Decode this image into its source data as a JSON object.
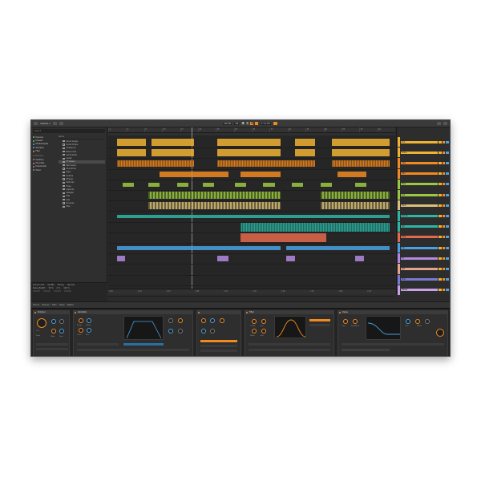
{
  "titlebar": {
    "project": "Untitled 1",
    "tempo": "120.00",
    "signature": "4/4",
    "position": "1.1.1.00",
    "transport_play": "▶",
    "transport_stop": "■",
    "transport_rec": "●"
  },
  "browser": {
    "search_placeholder": "Search",
    "places": [
      {
        "label": "Devices",
        "color": "#5bc55b"
      },
      {
        "label": "Presets",
        "color": "#5bc55b"
      },
      {
        "label": "Multisamples",
        "color": "#4aa7e8"
      },
      {
        "label": "Samples",
        "color": "#4aa7e8"
      },
      {
        "label": "Files",
        "color": "#f08a21"
      }
    ],
    "section_collections": "Collections",
    "collections": [
      {
        "label": "Desktop",
        "color": "#888888"
      },
      {
        "label": "Favorites",
        "color": "#e86aa8"
      },
      {
        "label": "Downloads",
        "color": "#888888"
      },
      {
        "label": "Music",
        "color": "#888888"
      }
    ],
    "list_header": "Name",
    "rows": [
      "Drum Loops",
      "Vocal Chops",
      "Ambience",
      "Bass Lines",
      "Synth Pads",
      "Leads",
      "FX Risers",
      "Percussion",
      "One Shots",
      "Keys",
      "Guitars",
      "Strings",
      "Textures",
      "Foley",
      "Impacts",
      "Sweeps",
      "Hits",
      "Kits",
      "Grooves",
      "Misc"
    ],
    "selected_row": 6
  },
  "info": {
    "labels": [
      "Groove Amt",
      "Shuffle",
      "Timing",
      "Velocity"
    ],
    "values": [
      "Swing Eighth",
      "50 %",
      "0 %",
      "100 %"
    ]
  },
  "ruler": [
    "1",
    "5",
    "9",
    "13",
    "17",
    "21",
    "25",
    "29",
    "33",
    "37",
    "41",
    "45",
    "49",
    "53",
    "57",
    "61"
  ],
  "footer_times": [
    "0:00",
    "0:16",
    "0:32",
    "0:48",
    "1:04",
    "1:20",
    "1:36",
    "1:52",
    "2:08",
    "2:24"
  ],
  "tracks": [
    {
      "name": "Kick",
      "color": "#f0b232"
    },
    {
      "name": "Snare",
      "color": "#f0b232"
    },
    {
      "name": "Hats",
      "color": "#f08a21"
    },
    {
      "name": "Perc",
      "color": "#f08a21"
    },
    {
      "name": "Bass",
      "color": "#9bc842"
    },
    {
      "name": "Sub",
      "color": "#9bc842"
    },
    {
      "name": "Pluck",
      "color": "#d9c07a"
    },
    {
      "name": "Chords",
      "color": "#2fb5a5"
    },
    {
      "name": "Arp",
      "color": "#2fb5a5"
    },
    {
      "name": "Lead",
      "color": "#e36a4b"
    },
    {
      "name": "Vox",
      "color": "#49a1e1"
    },
    {
      "name": "FX",
      "color": "#b389e0"
    },
    {
      "name": "Pad",
      "color": "#e5a38c"
    },
    {
      "name": "Ride",
      "color": "#7a7ad6"
    },
    {
      "name": "Master",
      "color": "#c9a0e6"
    }
  ],
  "devices_bar": {
    "title": "Device",
    "items": [
      "Polymer",
      "Filter",
      "Delay",
      "Master"
    ]
  },
  "devices": [
    {
      "title": "Polymer",
      "labels": [
        "Osc",
        "Pitch",
        "Glide",
        "Tone"
      ]
    },
    {
      "title": "Oscillator",
      "labels": [
        "Shape",
        "Width",
        "Level",
        "Fine"
      ]
    },
    {
      "title": "Filter",
      "labels": [
        "Cutoff",
        "Res",
        "Drive",
        "Env"
      ]
    },
    {
      "title": "Delay",
      "labels": [
        "Time",
        "Feedback",
        "Mix",
        "Width"
      ]
    }
  ]
}
